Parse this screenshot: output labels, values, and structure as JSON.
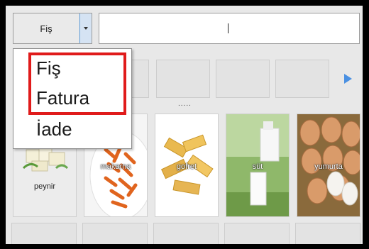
{
  "document_type": {
    "selected": "Fiş",
    "options": [
      "Fiş",
      "Fatura",
      "İade"
    ]
  },
  "search": {
    "value": ""
  },
  "category_row": {
    "ellipsis": "....."
  },
  "products": [
    {
      "label": "peynir"
    },
    {
      "label": "makarna"
    },
    {
      "label": "gofret"
    },
    {
      "label": "süt"
    },
    {
      "label": "yumurta"
    }
  ],
  "colors": {
    "accent": "#4a90e2",
    "highlight": "#e01b1b"
  },
  "icons": {
    "dropdown": "chevron-down-icon",
    "next": "play-next-icon"
  }
}
